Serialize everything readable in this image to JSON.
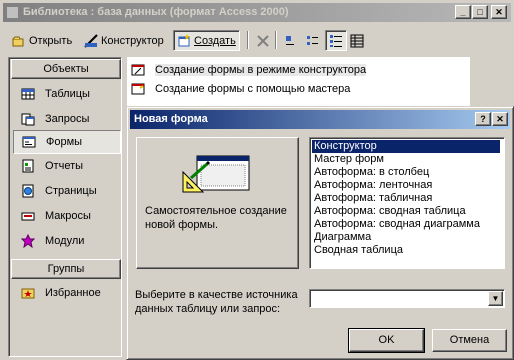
{
  "main_window": {
    "title": "Библиотека : база данных (формат Access 2000)",
    "controls": {
      "minimize": "_",
      "maximize": "□",
      "close": "✕"
    }
  },
  "toolbar": {
    "open_label": "Открыть",
    "design_label": "Конструктор",
    "create_label": "Создать",
    "delete_icon": "delete-icon",
    "view_icons": [
      "large-icons-icon",
      "small-icons-icon",
      "list-view-icon",
      "details-view-icon"
    ]
  },
  "objects_bar": {
    "header": "Объекты",
    "items": [
      {
        "label": "Таблицы",
        "icon": "table-icon"
      },
      {
        "label": "Запросы",
        "icon": "query-icon"
      },
      {
        "label": "Формы",
        "icon": "form-icon",
        "selected": true
      },
      {
        "label": "Отчеты",
        "icon": "report-icon"
      },
      {
        "label": "Страницы",
        "icon": "page-icon"
      },
      {
        "label": "Макросы",
        "icon": "macro-icon"
      },
      {
        "label": "Модули",
        "icon": "module-icon"
      }
    ],
    "groups_header": "Группы",
    "groups": [
      {
        "label": "Избранное",
        "icon": "favorites-icon"
      }
    ]
  },
  "object_list": [
    {
      "label": "Создание формы в режиме конструктора",
      "selected": true
    },
    {
      "label": "Создание формы с помощью мастера"
    }
  ],
  "dialog": {
    "title": "Новая форма",
    "controls": {
      "help": "?",
      "close": "✕"
    },
    "description": "Самостоятельное создание новой формы.",
    "form_types": [
      "Конструктор",
      "Мастер форм",
      "Автоформа: в столбец",
      "Автоформа: ленточная",
      "Автоформа: табличная",
      "Автоформа: сводная таблица",
      "Автоформа: сводная диаграмма",
      "Диаграмма",
      "Сводная таблица"
    ],
    "selected_type": "Конструктор",
    "source_label": "Выберите в качестве источника данных таблицу или запрос:",
    "source_value": "",
    "ok_label": "OK",
    "cancel_label": "Отмена"
  },
  "colors": {
    "active_title": "#0a246a",
    "active_title_end": "#a6caf0",
    "inactive_title": "#808080",
    "face": "#d4d0c8"
  }
}
